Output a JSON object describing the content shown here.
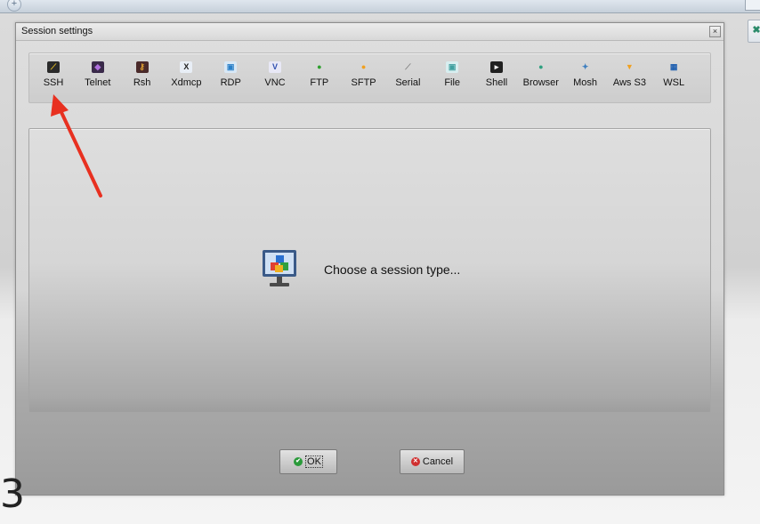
{
  "dialog": {
    "title": "Session settings",
    "close_glyph": "×"
  },
  "session_types": [
    {
      "label": "SSH",
      "icon": "ssh-icon",
      "glyph": "⟋",
      "color": "#e8c020",
      "bg": "#2a2a2a"
    },
    {
      "label": "Telnet",
      "icon": "telnet-icon",
      "glyph": "◆",
      "color": "#b070e0",
      "bg": "#3a2a4a"
    },
    {
      "label": "Rsh",
      "icon": "rsh-icon",
      "glyph": "⚷",
      "color": "#e0a030",
      "bg": "#4a2a2a"
    },
    {
      "label": "Xdmcp",
      "icon": "xdmcp-icon",
      "glyph": "X",
      "color": "#202020",
      "bg": "#e8eef6"
    },
    {
      "label": "RDP",
      "icon": "rdp-icon",
      "glyph": "▣",
      "color": "#2a80c8",
      "bg": "#d8e8f6"
    },
    {
      "label": "VNC",
      "icon": "vnc-icon",
      "glyph": "V",
      "color": "#3050b0",
      "bg": "#e8e8f6"
    },
    {
      "label": "FTP",
      "icon": "ftp-icon",
      "glyph": "●",
      "color": "#30a030",
      "bg": "transparent"
    },
    {
      "label": "SFTP",
      "icon": "sftp-icon",
      "glyph": "●",
      "color": "#f0a020",
      "bg": "transparent"
    },
    {
      "label": "Serial",
      "icon": "serial-icon",
      "glyph": "⟋",
      "color": "#808080",
      "bg": "transparent"
    },
    {
      "label": "File",
      "icon": "file-icon",
      "glyph": "▣",
      "color": "#40a0a0",
      "bg": "#d8eef0"
    },
    {
      "label": "Shell",
      "icon": "shell-icon",
      "glyph": "▸",
      "color": "#f0f0f0",
      "bg": "#202020"
    },
    {
      "label": "Browser",
      "icon": "browser-icon",
      "glyph": "●",
      "color": "#30a080",
      "bg": "transparent"
    },
    {
      "label": "Mosh",
      "icon": "mosh-icon",
      "glyph": "✦",
      "color": "#4080c0",
      "bg": "transparent"
    },
    {
      "label": "Aws S3",
      "icon": "aws-s3-icon",
      "glyph": "▼",
      "color": "#f0a020",
      "bg": "transparent"
    },
    {
      "label": "WSL",
      "icon": "wsl-icon",
      "glyph": "▦",
      "color": "#2060b0",
      "bg": "transparent"
    }
  ],
  "content": {
    "prompt": "Choose a session type..."
  },
  "buttons": {
    "ok_label": "OK",
    "cancel_label": "Cancel"
  },
  "overlay": {
    "digit": "3",
    "arrow_color": "#e83020"
  },
  "topbar": {
    "plus_glyph": "+"
  }
}
